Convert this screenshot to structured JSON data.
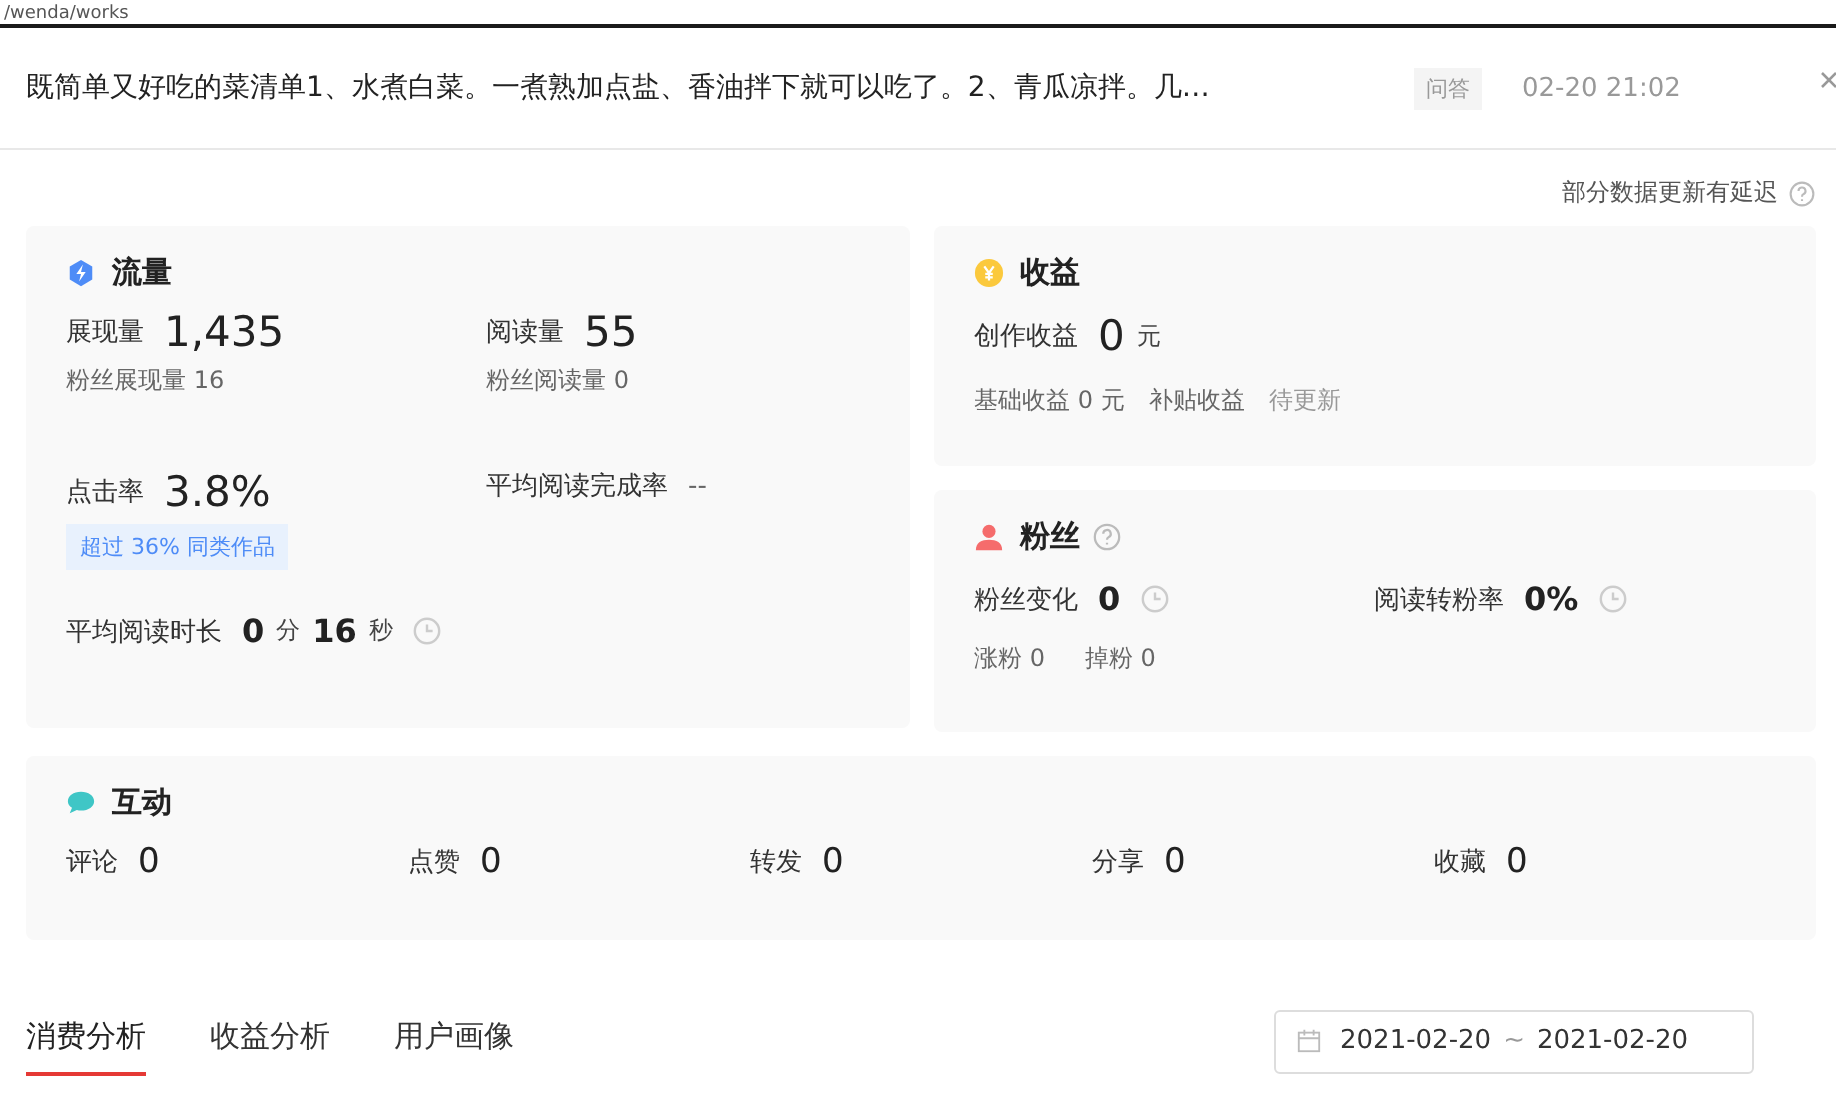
{
  "browser_bar": {
    "url": "/wenda/works"
  },
  "article": {
    "title": "既简单又好吃的菜清单1、水煮白菜。一煮熟加点盐、香油拌下就可以吃了。2、青瓜凉拌。几…",
    "tag": "问答",
    "time": "02-20 21:02"
  },
  "notice": "部分数据更新有延迟",
  "traffic": {
    "title": "流量",
    "metrics": [
      {
        "label": "展现量",
        "value": "1,435",
        "sub": "粉丝展现量 16"
      },
      {
        "label": "阅读量",
        "value": "55",
        "sub": "粉丝阅读量 0"
      },
      {
        "label": "点击率",
        "value": "3.8%",
        "badge": "超过 36% 同类作品"
      },
      {
        "label": "平均阅读完成率",
        "value": "--"
      }
    ],
    "duration": {
      "label": "平均阅读时长",
      "min": "0",
      "min_unit": "分",
      "sec": "16",
      "sec_unit": "秒"
    }
  },
  "income": {
    "title": "收益",
    "label": "创作收益",
    "value": "0",
    "unit": "元",
    "subs": [
      "基础收益 0 元",
      "补贴收益",
      "待更新"
    ]
  },
  "fans": {
    "title": "粉丝",
    "metrics": [
      {
        "label": "粉丝变化",
        "value": "0"
      },
      {
        "label": "阅读转粉率",
        "value": "0%"
      }
    ],
    "subs": [
      "涨粉 0",
      "掉粉 0"
    ]
  },
  "interaction": {
    "title": "互动",
    "metrics": [
      {
        "label": "评论",
        "value": "0"
      },
      {
        "label": "点赞",
        "value": "0"
      },
      {
        "label": "转发",
        "value": "0"
      },
      {
        "label": "分享",
        "value": "0"
      },
      {
        "label": "收藏",
        "value": "0"
      }
    ]
  },
  "tabs": [
    {
      "label": "消费分析",
      "selected": true
    },
    {
      "label": "收益分析",
      "selected": false
    },
    {
      "label": "用户画像",
      "selected": false
    }
  ],
  "date_range": {
    "start": "2021-02-20",
    "separator": "~",
    "end": "2021-02-20"
  }
}
